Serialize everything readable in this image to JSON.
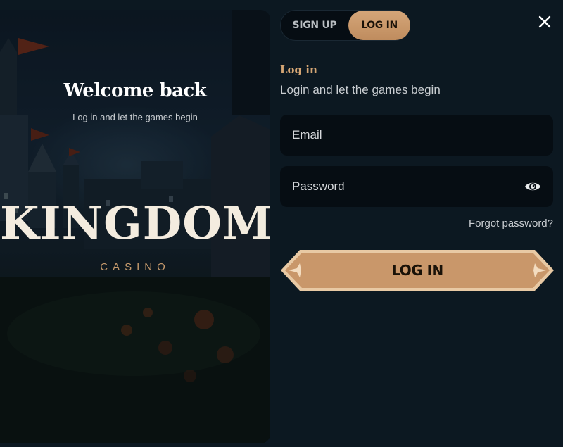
{
  "hero": {
    "title": "Welcome back",
    "subtitle": "Log in and let the games begin",
    "logo_word": "KINGDOM",
    "logo_sub": "CASINO"
  },
  "tabs": [
    {
      "label": "SIGN UP",
      "active": false
    },
    {
      "label": "LOG IN",
      "active": true
    }
  ],
  "close_icon": "close-icon",
  "form": {
    "heading": "Log in",
    "subheading": "Login and let the games begin",
    "email": {
      "placeholder": "Email",
      "value": ""
    },
    "password": {
      "placeholder": "Password",
      "value": "",
      "toggle_icon": "eye-icon"
    },
    "forgot_label": "Forgot password?",
    "submit_label": "LOG IN"
  },
  "colors": {
    "background": "#0c1821",
    "field_bg": "#060d13",
    "accent_gold": "#d4a574",
    "button_gold": "#c9976a"
  }
}
